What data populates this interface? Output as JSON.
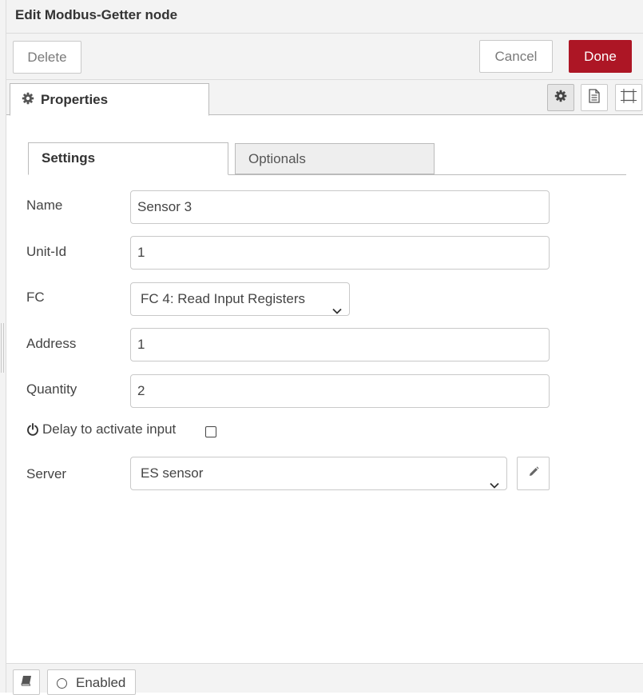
{
  "header": {
    "title": "Edit Modbus-Getter node"
  },
  "actions": {
    "delete_label": "Delete",
    "cancel_label": "Cancel",
    "done_label": "Done"
  },
  "tabs": {
    "properties_label": "Properties"
  },
  "side_buttons": [
    "gear-icon",
    "document-icon",
    "frame-icon"
  ],
  "settings_tabs": {
    "settings_label": "Settings",
    "optionals_label": "Optionals"
  },
  "form": {
    "name": {
      "label": "Name",
      "value": "Sensor 3"
    },
    "unit_id": {
      "label": "Unit-Id",
      "value": "1"
    },
    "fc": {
      "label": "FC",
      "value": "FC 4: Read Input Registers"
    },
    "address": {
      "label": "Address",
      "value": "1"
    },
    "quantity": {
      "label": "Quantity",
      "value": "2"
    },
    "delay": {
      "label": "Delay to activate input",
      "checked": false
    },
    "server": {
      "label": "Server",
      "value": "ES sensor"
    }
  },
  "footer": {
    "enabled_label": "Enabled"
  },
  "colors": {
    "accent": "#ad1625",
    "panel_bg": "#f3f3f3",
    "border": "#c9c9c9"
  }
}
